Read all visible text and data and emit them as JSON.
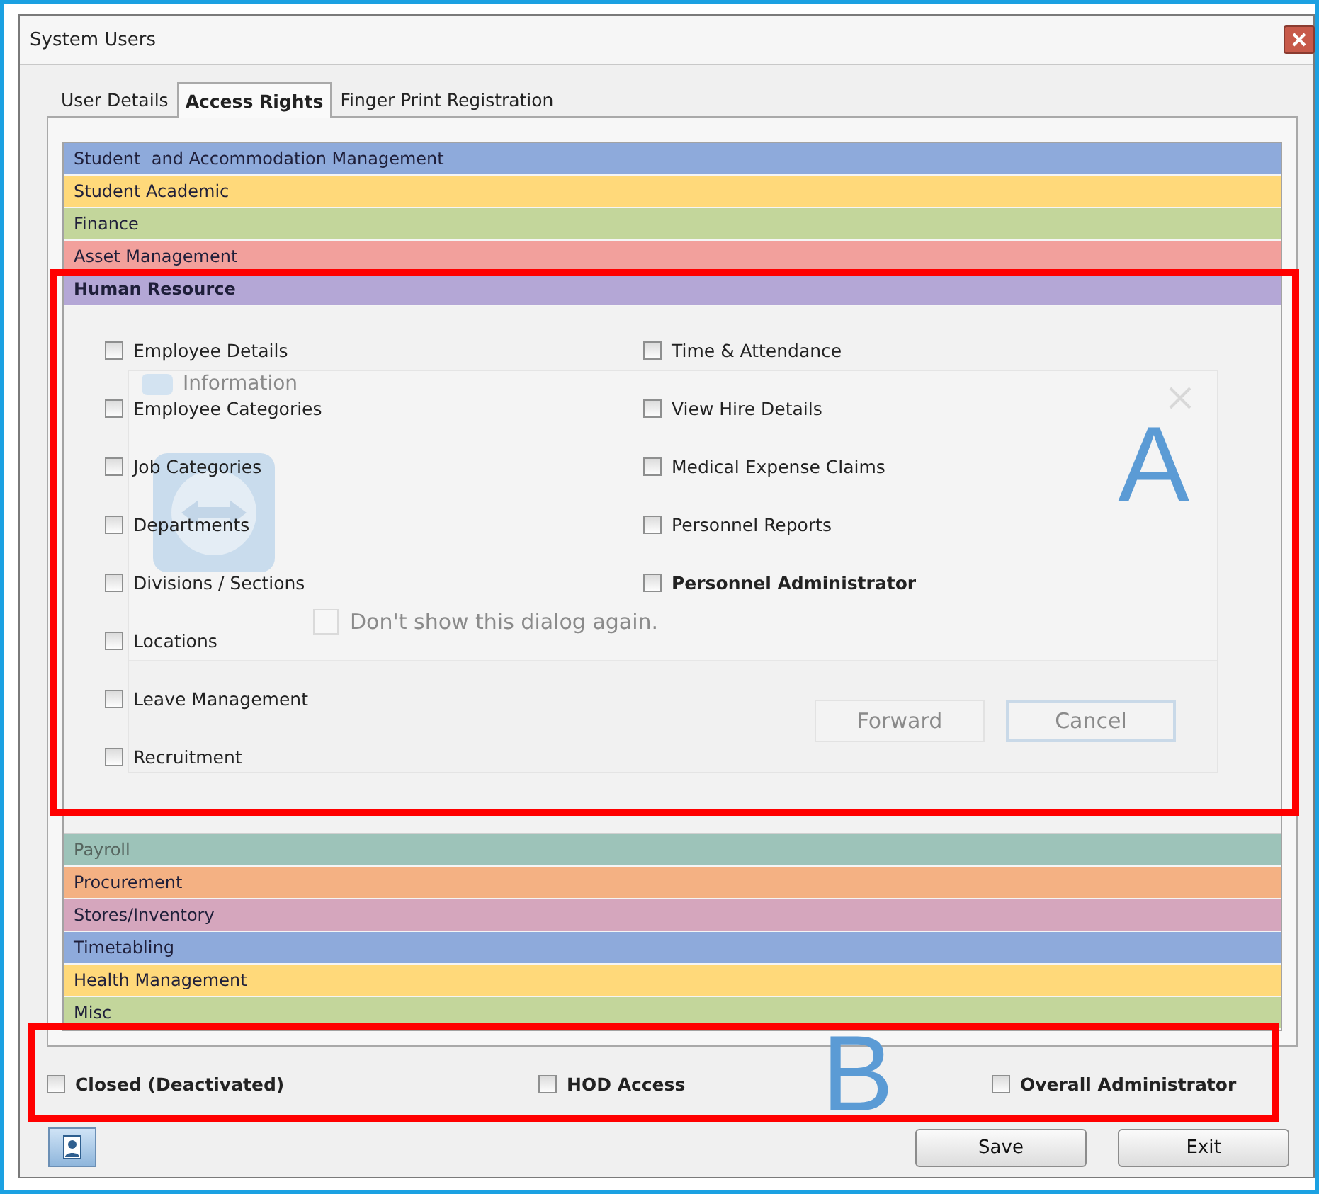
{
  "window": {
    "title": "System Users"
  },
  "tabs": [
    {
      "label": "User Details",
      "selected": false
    },
    {
      "label": "Access Rights",
      "selected": true
    },
    {
      "label": "Finger Print Registration",
      "selected": false
    }
  ],
  "sections": [
    {
      "title": "Student  and Accommodation Management",
      "color": "#8eaadb",
      "expanded": false,
      "disabled": false
    },
    {
      "title": "Student Academic",
      "color": "#ffd97a",
      "expanded": false,
      "disabled": false
    },
    {
      "title": "Finance",
      "color": "#c3d69b",
      "expanded": false,
      "disabled": false
    },
    {
      "title": "Asset Management",
      "color": "#f2a09c",
      "expanded": false,
      "disabled": false
    },
    {
      "title": "Human Resource",
      "color": "#b4a7d6",
      "expanded": true,
      "disabled": false,
      "columns": [
        [
          {
            "label": "Employee Details",
            "kind": "right",
            "checked": false
          },
          {
            "label": "Employee Categories",
            "kind": "right",
            "checked": false
          },
          {
            "label": "Job Categories",
            "kind": "right",
            "checked": false
          },
          {
            "label": "Departments",
            "kind": "right",
            "checked": false
          },
          {
            "label": "Divisions / Sections",
            "kind": "right",
            "checked": false
          },
          {
            "label": "Locations",
            "kind": "right",
            "checked": false
          },
          {
            "label": "Leave Management",
            "kind": "right",
            "checked": false
          },
          {
            "label": "Recruitment",
            "kind": "right",
            "checked": false
          }
        ],
        [
          {
            "label": "Time & Attendance",
            "kind": "right",
            "checked": false
          },
          {
            "label": "View Hire Details",
            "kind": "right",
            "checked": false
          },
          {
            "label": "Medical Expense Claims",
            "kind": "right",
            "checked": false
          },
          {
            "label": "Personnel Reports",
            "kind": "right",
            "checked": false
          },
          {
            "label": "Personnel Administrator",
            "kind": "admin",
            "checked": false
          }
        ]
      ]
    },
    {
      "title": "Payroll",
      "color": "#9dc3b9",
      "expanded": false,
      "disabled": true
    },
    {
      "title": "Procurement",
      "color": "#f4b183",
      "expanded": false,
      "disabled": false
    },
    {
      "title": "Stores/Inventory",
      "color": "#d5a6bd",
      "expanded": false,
      "disabled": false
    },
    {
      "title": "Timetabling",
      "color": "#8eaadb",
      "expanded": false,
      "disabled": false
    },
    {
      "title": "Health Management",
      "color": "#ffd97a",
      "expanded": false,
      "disabled": false
    },
    {
      "title": "Misc",
      "color": "#c3d69b",
      "expanded": false,
      "disabled": false
    }
  ],
  "faded_dialog": {
    "title": "Information",
    "checkbox": {
      "label": "Don't show this dialog again.",
      "checked": false
    },
    "buttons": [
      {
        "label": "Forward"
      },
      {
        "label": "Cancel"
      }
    ]
  },
  "options": [
    {
      "label": "Closed (Deactivated)",
      "checked": false
    },
    {
      "label": "HOD Access",
      "checked": false
    },
    {
      "label": "Overall Administrator",
      "checked": false
    }
  ],
  "buttons": [
    {
      "label": "Save"
    },
    {
      "label": "Exit"
    }
  ],
  "annotations": [
    {
      "label": "A"
    },
    {
      "label": "B"
    }
  ]
}
